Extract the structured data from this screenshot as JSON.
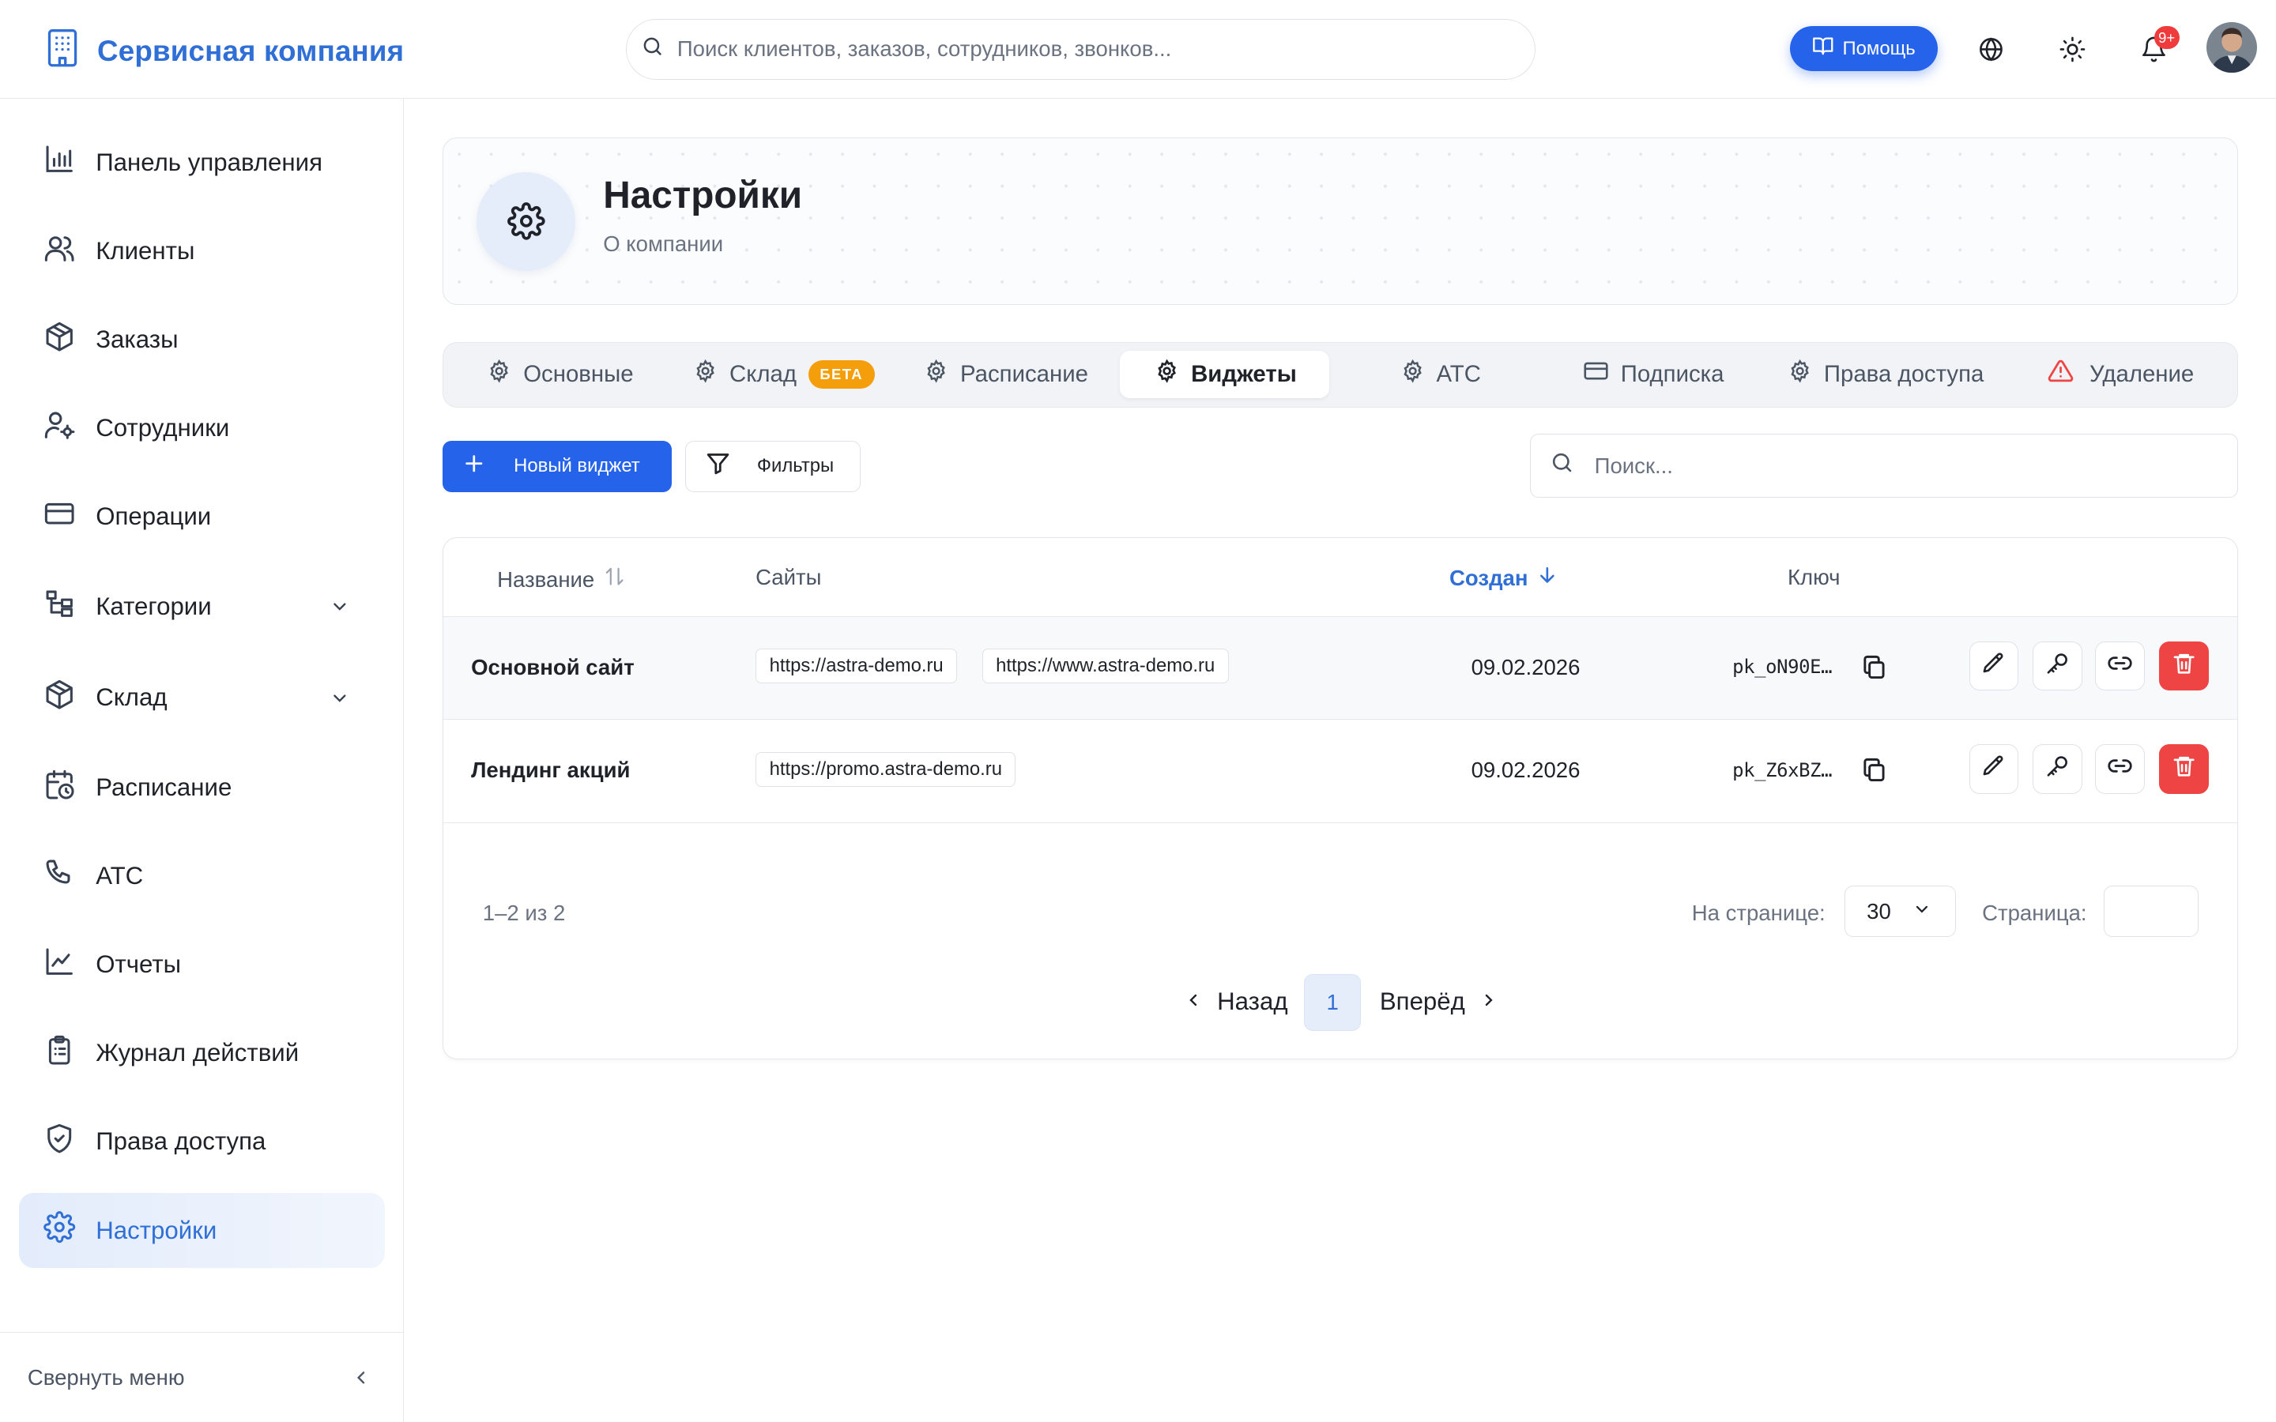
{
  "header": {
    "brand": "Сервисная компания",
    "search_placeholder": "Поиск клиентов, заказов, сотрудников, звонков...",
    "help_label": "Помощь",
    "notifications_badge": "9+"
  },
  "sidebar": {
    "items": [
      {
        "label": "Панель управления",
        "icon": "bar-chart-icon"
      },
      {
        "label": "Клиенты",
        "icon": "users-icon"
      },
      {
        "label": "Заказы",
        "icon": "box-icon"
      },
      {
        "label": "Сотрудники",
        "icon": "user-gear-icon"
      },
      {
        "label": "Операции",
        "icon": "credit-card-icon"
      },
      {
        "label": "Категории",
        "icon": "tree-icon",
        "expandable": true
      },
      {
        "label": "Склад",
        "icon": "box-icon",
        "expandable": true
      },
      {
        "label": "Расписание",
        "icon": "calendar-clock-icon"
      },
      {
        "label": "АТС",
        "icon": "phone-icon"
      },
      {
        "label": "Отчеты",
        "icon": "line-chart-icon"
      },
      {
        "label": "Журнал действий",
        "icon": "clipboard-icon"
      },
      {
        "label": "Права доступа",
        "icon": "shield-icon"
      },
      {
        "label": "Настройки",
        "icon": "gear-icon",
        "active": true
      }
    ],
    "collapse_label": "Свернуть меню"
  },
  "page": {
    "title": "Настройки",
    "subtitle": "О компании"
  },
  "tabs": [
    {
      "label": "Основные",
      "icon": "gear-icon"
    },
    {
      "label": "Склад",
      "icon": "gear-icon",
      "badge": "БЕТА"
    },
    {
      "label": "Расписание",
      "icon": "gear-icon"
    },
    {
      "label": "Виджеты",
      "icon": "gear-icon",
      "active": true
    },
    {
      "label": "АТС",
      "icon": "gear-icon"
    },
    {
      "label": "Подписка",
      "icon": "credit-card-icon"
    },
    {
      "label": "Права доступа",
      "icon": "gear-icon"
    },
    {
      "label": "Удаление",
      "icon": "warning-icon"
    }
  ],
  "toolbar": {
    "new_widget_label": "Новый виджет",
    "filters_label": "Фильтры",
    "search_placeholder": "Поиск..."
  },
  "table": {
    "columns": {
      "name": "Название",
      "sites": "Сайты",
      "created": "Создан",
      "key": "Ключ"
    },
    "sorted_column": "created",
    "sort_direction": "desc",
    "rows": [
      {
        "name": "Основной сайт",
        "sites": [
          "https://astra-demo.ru",
          "https://www.astra-demo.ru"
        ],
        "created": "09.02.2026",
        "key": "pk_oN90E…"
      },
      {
        "name": "Лендинг акций",
        "sites": [
          "https://promo.astra-demo.ru"
        ],
        "created": "09.02.2026",
        "key": "pk_Z6xBZ…"
      }
    ]
  },
  "pagination": {
    "count_label": "1–2 из 2",
    "per_page_label": "На странице:",
    "per_page_value": "30",
    "page_label": "Страница:",
    "prev_label": "Назад",
    "current_page": "1",
    "next_label": "Вперёд"
  },
  "colors": {
    "accent": "#2563eb",
    "brand_text": "#2f6fd6",
    "danger": "#ef4444",
    "beta_badge": "#f59e0b"
  }
}
